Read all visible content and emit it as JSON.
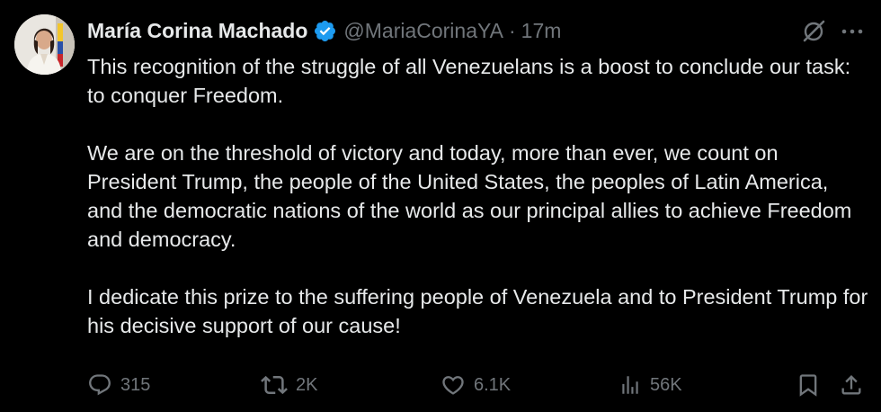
{
  "author": {
    "display_name": "María Corina Machado",
    "handle": "@MariaCorinaYA",
    "separator": "·",
    "timestamp": "17m",
    "verified": true,
    "verified_color": "#1d9bf0"
  },
  "icons": {
    "verified": "verified-badge-icon",
    "grok": "grok-icon",
    "more": "more-options-icon",
    "reply": "reply-icon",
    "repost": "repost-icon",
    "like": "like-icon",
    "views": "views-icon",
    "bookmark": "bookmark-icon",
    "share": "share-icon"
  },
  "tweet": {
    "paragraphs": [
      "This recognition of the struggle of all Venezuelans is a boost to conclude our task: to conquer Freedom.",
      "We are on the threshold of victory and today, more than ever, we count on President Trump, the people of the United States, the peoples of Latin America, and the democratic nations of the world as our principal allies to achieve Freedom and democracy.",
      "I dedicate this prize to the suffering people of Venezuela and to President Trump for his decisive support of our cause!"
    ]
  },
  "metrics": {
    "replies": "315",
    "reposts": "2K",
    "likes": "6.1K",
    "views": "56K"
  },
  "colors": {
    "background": "#000000",
    "text": "#e7e9ea",
    "secondary": "#71767b",
    "accent": "#1d9bf0"
  }
}
